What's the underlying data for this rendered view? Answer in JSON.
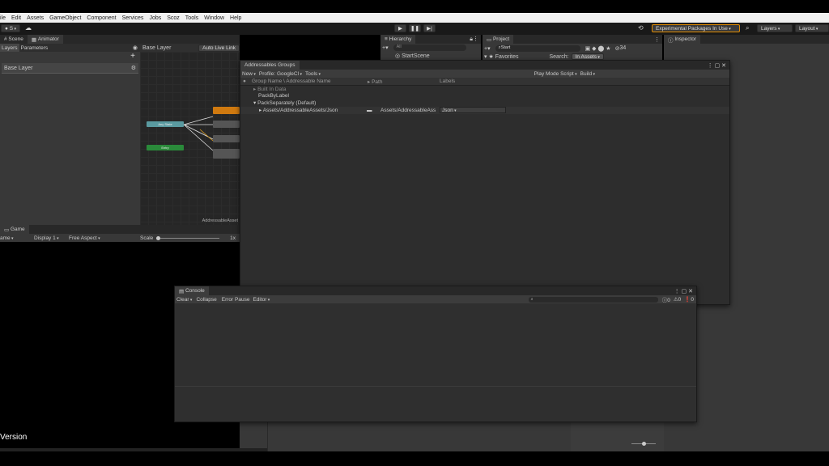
{
  "menu": [
    "ile",
    "Edit",
    "Assets",
    "GameObject",
    "Component",
    "Services",
    "Jobs",
    "Scoz",
    "Tools",
    "Window",
    "Help"
  ],
  "toolbar": {
    "account": "S",
    "experimental": "Experimental Packages In Use",
    "layers": "Layers",
    "layout": "Layout"
  },
  "left_top": {
    "tabs": [
      "Scene",
      "Animator"
    ],
    "sub_tabs": [
      "Layers",
      "Parameters"
    ],
    "layer_item": "Base Layer",
    "breadcrumb": "Base Layer",
    "live_link": "Auto Live Link",
    "graph_footer": "AddressableAsset",
    "nodes": [
      "Any State",
      "Entry"
    ]
  },
  "hierarchy": {
    "tab": "Hierarchy",
    "search_placeholder": "All",
    "item": "StartScene"
  },
  "project": {
    "tab": "Project",
    "search_value": "Start",
    "favorites": "Favorites",
    "search_label": "Search:",
    "search_scope": "In Assets",
    "count": "34"
  },
  "inspector": {
    "tab": "Inspector"
  },
  "addressables": {
    "title": "Addressables Groups",
    "new": "New",
    "profile": "Profile: GoogleCl",
    "tools": "Tools",
    "play_mode": "Play Mode Script",
    "build": "Build",
    "col_name": "Group Name \\ Addressable Name",
    "col_path": "Path",
    "col_labels": "Labels",
    "rows": [
      {
        "name": "Built In Data",
        "indent": 1
      },
      {
        "name": "PackByLabel",
        "indent": 1
      },
      {
        "name": "PackSeparately (Default)",
        "indent": 1
      },
      {
        "name": "Assets/AddressableAssets/Json",
        "indent": 2,
        "path": "Assets/AddressableAss",
        "label": "Json"
      }
    ]
  },
  "game": {
    "tab": "Game",
    "display_mode": "ame",
    "display": "Display 1",
    "aspect": "Free Aspect",
    "scale_label": "Scale",
    "scale_value": "1x",
    "version": "Version"
  },
  "console": {
    "title": "Console",
    "clear": "Clear",
    "collapse": "Collapse",
    "error_pause": "Error Pause",
    "editor": "Editor",
    "count_info": "0",
    "count_warn": "0",
    "count_error": "0"
  }
}
